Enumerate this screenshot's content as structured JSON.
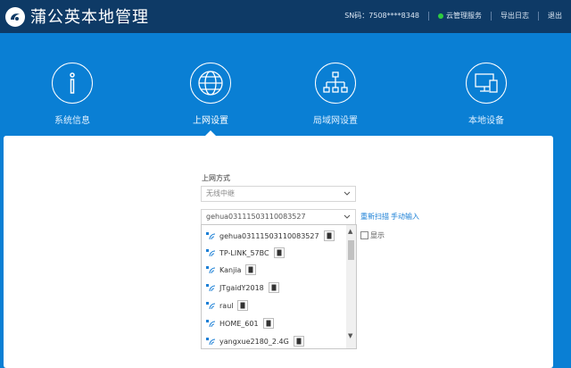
{
  "header": {
    "title": "蒲公英本地管理",
    "sn": "SN码：7508****8348",
    "cloud_service": "云管理服务",
    "export_log": "导出日志",
    "logout": "退出"
  },
  "nav": [
    {
      "label": "系统信息",
      "icon": "info-icon"
    },
    {
      "label": "上网设置",
      "icon": "globe-icon"
    },
    {
      "label": "局域网设置",
      "icon": "network-icon"
    },
    {
      "label": "本地设备",
      "icon": "monitor-icon"
    }
  ],
  "form": {
    "wan_label": "上网方式",
    "wan_mode": "无线中继",
    "ssid_value": "gehua03111503110083527",
    "rescan": "重新扫描",
    "manual": "手动输入",
    "show_label": "显示"
  },
  "ssid_list": [
    "gehua03111503110083527",
    "TP-LINK_57BC",
    "Kanjia",
    "JTgaidY2018",
    "raul",
    "HOME_601",
    "yangxue2180_2.4G"
  ],
  "colors": {
    "header_bg": "#0e3a66",
    "nav_bg": "#0a7fd4",
    "link": "#1a7fd6",
    "status_ok": "#2ecc40"
  }
}
